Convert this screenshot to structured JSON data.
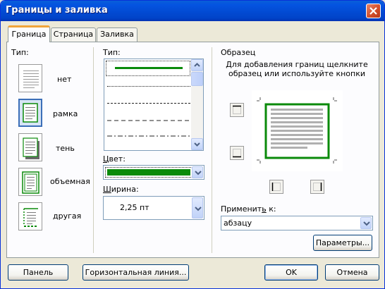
{
  "window": {
    "title": "Границы и заливка"
  },
  "tabs": [
    {
      "label": "Граница",
      "active": true
    },
    {
      "label": "Страница",
      "active": false
    },
    {
      "label": "Заливка",
      "active": false
    }
  ],
  "type_section": {
    "label": "Тип:",
    "presets": [
      {
        "label": "нет",
        "icon": "border-none-icon",
        "selected": false
      },
      {
        "label": "рамка",
        "icon": "border-box-icon",
        "selected": true
      },
      {
        "label": "тень",
        "icon": "border-shadow-icon",
        "selected": false
      },
      {
        "label": "объемная",
        "icon": "border-3d-icon",
        "selected": false
      },
      {
        "label": "другая",
        "icon": "border-custom-icon",
        "selected": false
      }
    ]
  },
  "style_section": {
    "type_label": "Тип:",
    "line_styles": [
      "solid",
      "dotted",
      "dashed-fine",
      "dashed",
      "dash-dot"
    ],
    "selected_style": "solid",
    "color_label": "Цвет:",
    "color_value": "#0a8a0a",
    "width_label": "Ширина:",
    "width_value": "2,25 пт"
  },
  "preview_section": {
    "label": "Образец",
    "hint": "Для добавления границ щелкните образец или используйте кнопки",
    "border_color": "#0a8a0a",
    "apply_label": "Применить к:",
    "apply_value": "абзацу",
    "params_button": "Параметры..."
  },
  "footer": {
    "toolbar_button": "Панель",
    "hline_button": "Горизонтальная линия...",
    "ok_button": "OK",
    "cancel_button": "Отмена"
  },
  "colors": {
    "title_bar": "#0143c8",
    "dialog_bg": "#ece9d8",
    "tab_accent": "#f0a53a",
    "border_green": "#0a8a0a"
  }
}
